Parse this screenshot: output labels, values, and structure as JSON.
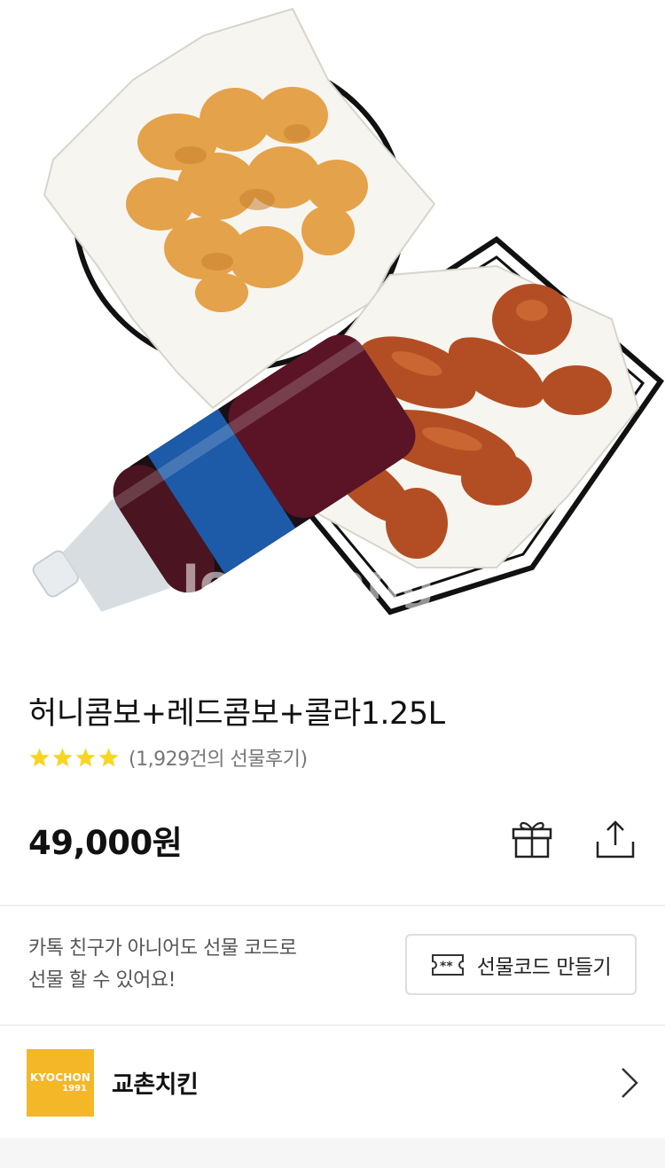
{
  "product": {
    "image_watermark": "Joongang",
    "title": "허니콤보+레드콤보+콜라1.25L",
    "rating": {
      "stars": 4,
      "review_count_text": "(1,929건의 선물후기)"
    },
    "price": "49,000원"
  },
  "actions": {
    "gift_icon": "gift-icon",
    "share_icon": "share-icon"
  },
  "gift_code": {
    "description_line1": "카톡 친구가 아니어도 선물 코드로",
    "description_line2": "선물 할 수 있어요!",
    "button_label": "선물코드 만들기",
    "button_icon": "ticket-icon"
  },
  "brand": {
    "logo_line1": "KYOCHON",
    "logo_line2": "1991",
    "name": "교촌치킨",
    "chevron_icon": "chevron-right-icon"
  },
  "colors": {
    "star": "#f7d521",
    "brand_yellow": "#f4b728",
    "divider": "#eeeeee"
  }
}
